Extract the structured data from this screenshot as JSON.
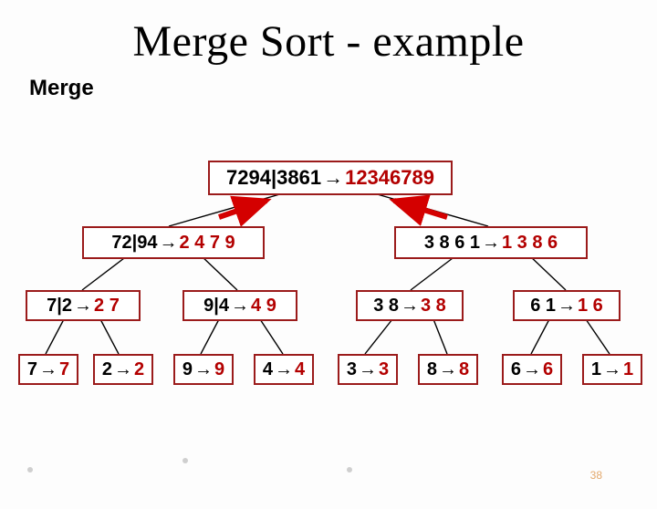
{
  "title": "Merge Sort - example",
  "subtitle": "Merge",
  "arrow": "→",
  "page_number": "38",
  "nodes": {
    "root": {
      "left": "7294|3861",
      "right": "12346789"
    },
    "l1a": {
      "left": "72|94",
      "right": "2 4 7 9"
    },
    "l1b": {
      "left": "3 8 6 1",
      "right": "1 3 8 6"
    },
    "l2a": {
      "left": "7|2",
      "right": "2 7"
    },
    "l2b": {
      "left": "9|4",
      "right": "4 9"
    },
    "l2c": {
      "left": "3 8",
      "right": "3 8"
    },
    "l2d": {
      "left": "6 1",
      "right": "1 6"
    },
    "l3a": {
      "left": "7",
      "right": "7"
    },
    "l3b": {
      "left": "2",
      "right": "2"
    },
    "l3c": {
      "left": "9",
      "right": "9"
    },
    "l3d": {
      "left": "4",
      "right": "4"
    },
    "l3e": {
      "left": "3",
      "right": "3"
    },
    "l3f": {
      "left": "8",
      "right": "8"
    },
    "l3g": {
      "left": "6",
      "right": "6"
    },
    "l3h": {
      "left": "1",
      "right": "1"
    }
  }
}
